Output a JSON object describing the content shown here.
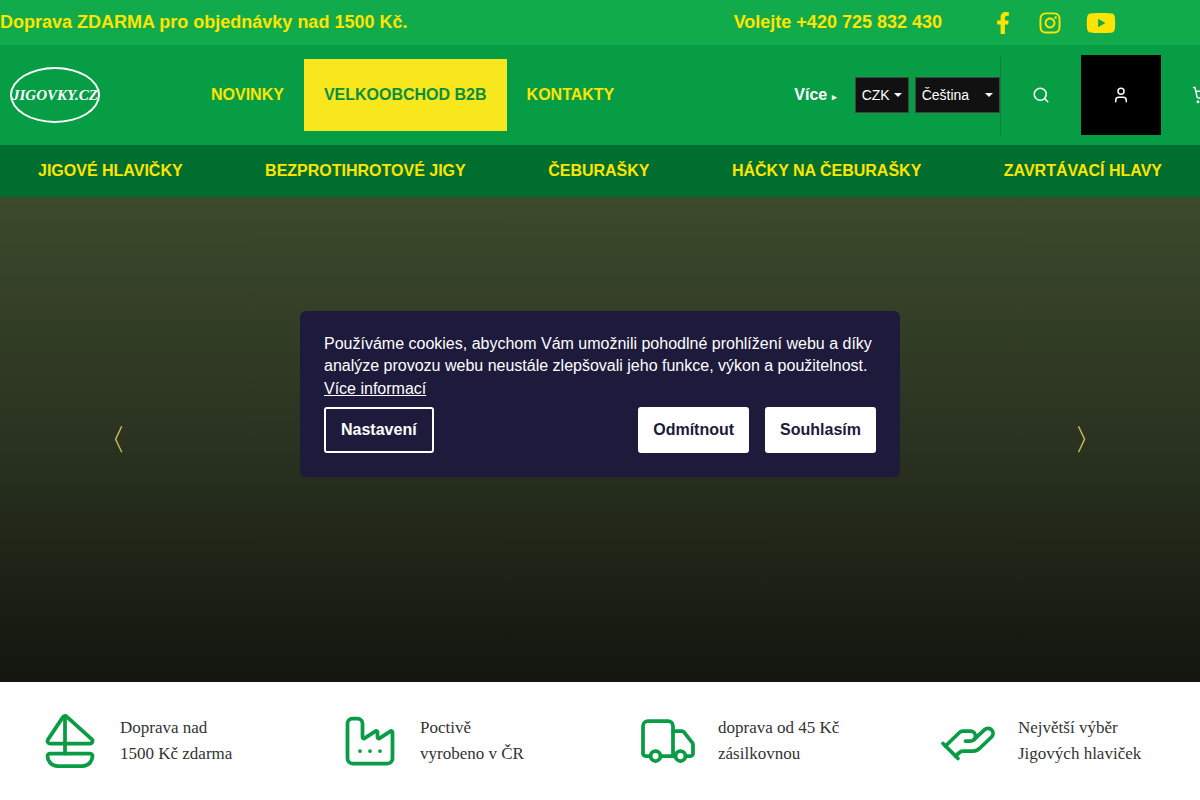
{
  "top_bar": {
    "shipping_notice": "Doprava ZDARMA pro objednávky nad 1500 Kč.",
    "phone": "Volejte +420 725 832 430"
  },
  "header": {
    "logo": "JIGOVKY.CZ",
    "nav": [
      {
        "label": "NOVINKY",
        "selected": false
      },
      {
        "label": "VELKOOBCHOD B2B",
        "selected": true
      },
      {
        "label": "KONTAKTY",
        "selected": false
      }
    ],
    "more": "Více",
    "currency": "CZK",
    "language": "Čeština"
  },
  "categories": [
    "JIGOVÉ HLAVIČKY",
    "BEZPROTIHROTOVÉ JIGY",
    "ČEBURAŠKY",
    "HÁČKY NA ČEBURAŠKY",
    "ZAVRTÁVACÍ HLAVY"
  ],
  "banner": {
    "prev": "〈",
    "next": "〉"
  },
  "cookie_dialog": {
    "message": "Používáme cookies, abychom Vám umožnili pohodlné prohlížení webu a díky analýze provozu webu neustále zlepšovali jeho funkce, výkon a použitelnost.",
    "link": "Více informací",
    "buttons": [
      "Nastavení",
      "Odmítnout",
      "Souhlasím"
    ]
  },
  "features": [
    {
      "lines": [
        "Doprava nad",
        "1500 Kč zdarma"
      ]
    },
    {
      "lines": [
        "Poctivě",
        "vyrobeno v ČR"
      ]
    },
    {
      "lines": [
        "doprava od 45 Kč",
        "zásilkovnou"
      ]
    },
    {
      "lines": [
        "Největší výběr",
        "Jigových hlaviček"
      ]
    }
  ]
}
